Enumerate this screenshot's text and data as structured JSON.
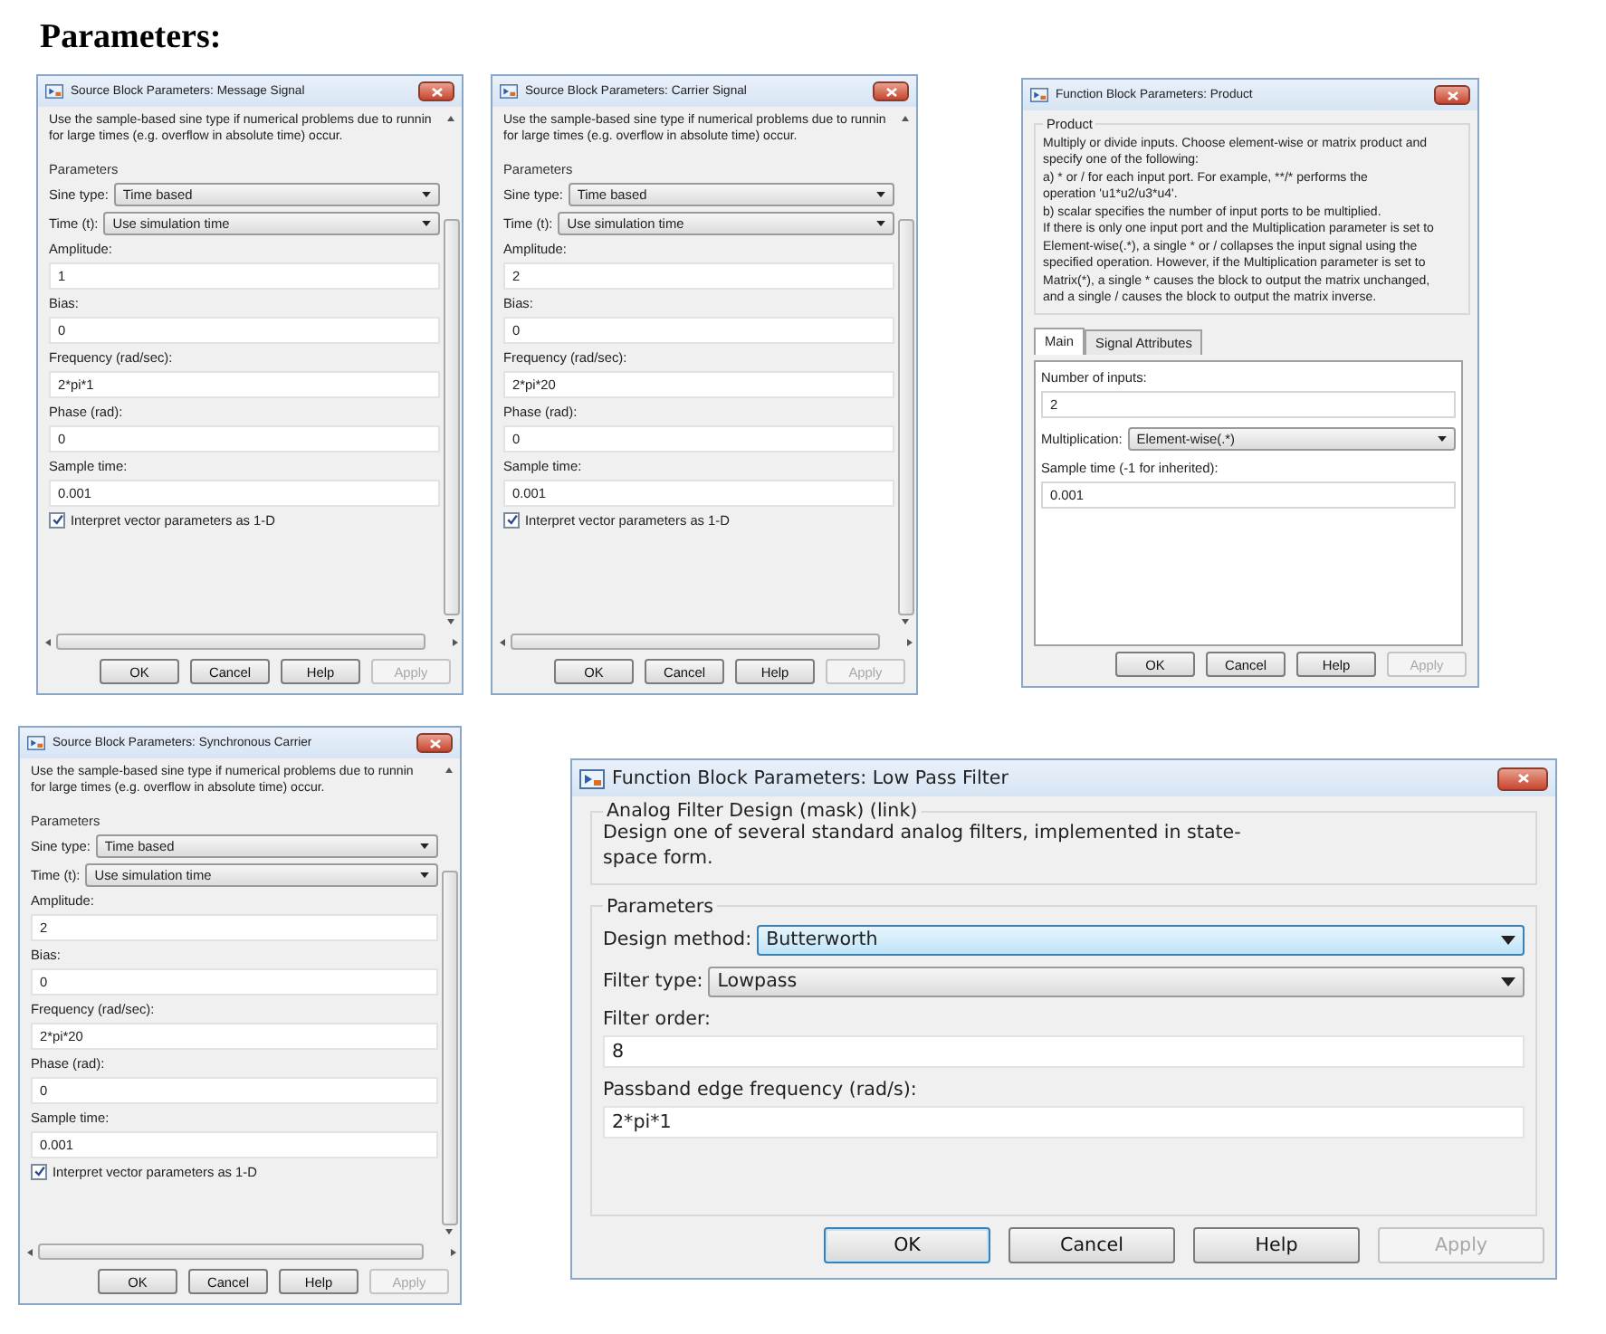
{
  "heading": "Parameters:",
  "rows": [
    [
      {
        "kind": "source",
        "title": "Source Block Parameters: Message Signal",
        "description": [
          "Use the sample-based sine type if numerical problems due to runnin",
          "for large times (e.g. overflow in absolute time) occur."
        ],
        "section": "Parameters",
        "fields": [
          {
            "kind": "dropdown",
            "label": "Sine type:",
            "value": "Time based"
          },
          {
            "kind": "dropdown",
            "label": "Time (t):",
            "value": "Use simulation time"
          },
          {
            "kind": "text",
            "label": "Amplitude:",
            "value": "1"
          },
          {
            "kind": "text",
            "label": "Bias:",
            "value": "0"
          },
          {
            "kind": "text",
            "label": "Frequency (rad/sec):",
            "value": "2*pi*1"
          },
          {
            "kind": "text",
            "label": "Phase (rad):",
            "value": "0"
          },
          {
            "kind": "text",
            "label": "Sample time:",
            "value": "0.001"
          },
          {
            "kind": "checkbox",
            "label": "Interpret vector parameters as 1-D",
            "checked": true
          }
        ],
        "buttons": [
          {
            "label": "OK",
            "disabled": false
          },
          {
            "label": "Cancel",
            "disabled": false
          },
          {
            "label": "Help",
            "disabled": false
          },
          {
            "label": "Apply",
            "disabled": true
          }
        ]
      },
      {
        "kind": "source",
        "title": "Source Block Parameters: Carrier Signal",
        "description": [
          "Use the sample-based sine type if numerical problems due to runnin",
          "for large times (e.g. overflow in absolute time) occur."
        ],
        "section": "Parameters",
        "fields": [
          {
            "kind": "dropdown",
            "label": "Sine type:",
            "value": "Time based"
          },
          {
            "kind": "dropdown",
            "label": "Time (t):",
            "value": "Use simulation time"
          },
          {
            "kind": "text",
            "label": "Amplitude:",
            "value": "2"
          },
          {
            "kind": "text",
            "label": "Bias:",
            "value": "0"
          },
          {
            "kind": "text",
            "label": "Frequency (rad/sec):",
            "value": "2*pi*20"
          },
          {
            "kind": "text",
            "label": "Phase (rad):",
            "value": "0"
          },
          {
            "kind": "text",
            "label": "Sample time:",
            "value": "0.001"
          },
          {
            "kind": "checkbox",
            "label": "Interpret vector parameters as 1-D",
            "checked": true
          }
        ],
        "buttons": [
          {
            "label": "OK",
            "disabled": false
          },
          {
            "label": "Cancel",
            "disabled": false
          },
          {
            "label": "Help",
            "disabled": false
          },
          {
            "label": "Apply",
            "disabled": true
          }
        ]
      },
      {
        "kind": "product",
        "title": "Function Block Parameters: Product",
        "group": "Product",
        "description": [
          "Multiply or divide inputs.  Choose element-wise or matrix product and",
          "specify one of the following:",
          " a) * or / for each input port. For example, **/* performs the",
          "operation 'u1*u2/u3*u4'.",
          " b) scalar specifies the number of input ports to be multiplied.",
          "If there is only one input port and the Multiplication parameter is set to",
          "Element-wise(.*), a single * or / collapses the input signal using the",
          "specified operation. However, if the Multiplication parameter is set to",
          "Matrix(*), a single * causes the block to output the matrix unchanged,",
          "and a single / causes the block to output the matrix inverse."
        ],
        "tabs": [
          {
            "label": "Main",
            "selected": true
          },
          {
            "label": "Signal Attributes",
            "selected": false
          }
        ],
        "fields": [
          {
            "kind": "text",
            "label": "Number of inputs:",
            "value": "2"
          },
          {
            "kind": "dropdown",
            "label": "Multiplication:",
            "value": "Element-wise(.*)"
          },
          {
            "kind": "text",
            "label": "Sample time (-1 for inherited):",
            "value": "0.001"
          }
        ],
        "buttons": [
          {
            "label": "OK",
            "disabled": false
          },
          {
            "label": "Cancel",
            "disabled": false
          },
          {
            "label": "Help",
            "disabled": false
          },
          {
            "label": "Apply",
            "disabled": true
          }
        ]
      }
    ],
    [
      {
        "kind": "source",
        "title": "Source Block Parameters: Synchronous Carrier",
        "description": [
          "Use the sample-based sine type if numerical problems due to runnin",
          "for large times (e.g. overflow in absolute time) occur."
        ],
        "section": "Parameters",
        "fields": [
          {
            "kind": "dropdown",
            "label": "Sine type:",
            "value": "Time based"
          },
          {
            "kind": "dropdown",
            "label": "Time (t):",
            "value": "Use simulation time"
          },
          {
            "kind": "text",
            "label": "Amplitude:",
            "value": "2"
          },
          {
            "kind": "text",
            "label": "Bias:",
            "value": "0"
          },
          {
            "kind": "text",
            "label": "Frequency (rad/sec):",
            "value": "2*pi*20"
          },
          {
            "kind": "text",
            "label": "Phase (rad):",
            "value": "0"
          },
          {
            "kind": "text",
            "label": "Sample time:",
            "value": "0.001"
          },
          {
            "kind": "checkbox",
            "label": "Interpret vector parameters as 1-D",
            "checked": true
          }
        ],
        "buttons": [
          {
            "label": "OK",
            "disabled": false
          },
          {
            "label": "Cancel",
            "disabled": false
          },
          {
            "label": "Help",
            "disabled": false
          },
          {
            "label": "Apply",
            "disabled": true
          }
        ]
      },
      {
        "kind": "filter",
        "title": "Function Block Parameters: Low Pass Filter",
        "group": "Analog Filter Design (mask) (link)",
        "description": [
          "Design one of several standard analog filters, implemented in state-",
          "space form."
        ],
        "section": "Parameters",
        "fields": [
          {
            "kind": "dropdown",
            "label": "Design method:",
            "value": "Butterworth",
            "focused": true
          },
          {
            "kind": "dropdown",
            "label": "Filter type:",
            "value": "Lowpass",
            "focused": false
          },
          {
            "kind": "text",
            "label": "Filter order:",
            "value": "8",
            "focused": false
          },
          {
            "kind": "text",
            "label": "Passband edge frequency (rad/s):",
            "value": "2*pi*1",
            "focused": false
          }
        ],
        "buttons": [
          {
            "label": "OK",
            "disabled": false,
            "default": true
          },
          {
            "label": "Cancel",
            "disabled": false,
            "default": false
          },
          {
            "label": "Help",
            "disabled": false,
            "default": false
          },
          {
            "label": "Apply",
            "disabled": true,
            "default": false
          }
        ]
      }
    ]
  ]
}
